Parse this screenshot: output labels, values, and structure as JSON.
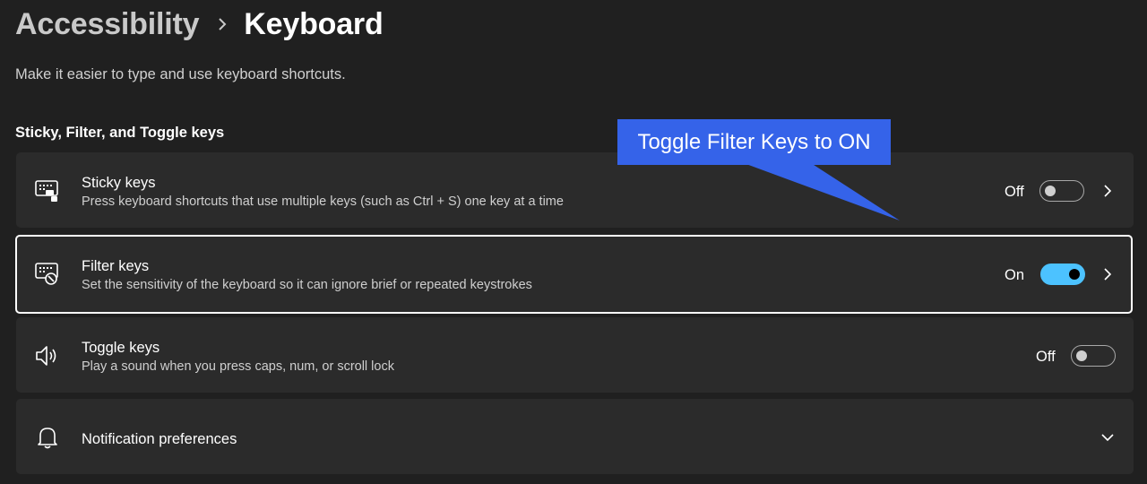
{
  "breadcrumb": {
    "parent": "Accessibility",
    "current": "Keyboard"
  },
  "description": "Make it easier to type and use keyboard shortcuts.",
  "section_title": "Sticky, Filter, and Toggle keys",
  "settings": [
    {
      "title": "Sticky keys",
      "subtitle": "Press keyboard shortcuts that use multiple keys (such as Ctrl + S) one key at a time",
      "state": "Off",
      "icon": "keyboard-sticky-icon"
    },
    {
      "title": "Filter keys",
      "subtitle": "Set the sensitivity of the keyboard so it can ignore brief or repeated keystrokes",
      "state": "On",
      "icon": "keyboard-filter-icon"
    },
    {
      "title": "Toggle keys",
      "subtitle": "Play a sound when you press caps, num, or scroll lock",
      "state": "Off",
      "icon": "speaker-icon"
    }
  ],
  "notifications": {
    "title": "Notification preferences",
    "icon": "bell-icon"
  },
  "callout": {
    "text": "Toggle Filter Keys to ON"
  },
  "colors": {
    "background": "#202020",
    "card": "#2b2b2b",
    "accent": "#4cc2ff",
    "callout": "#3563e9"
  }
}
